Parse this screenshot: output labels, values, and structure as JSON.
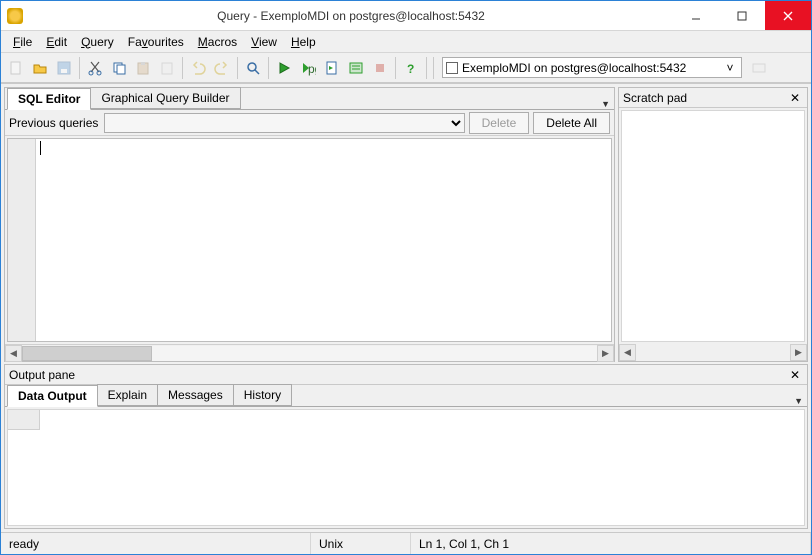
{
  "window": {
    "title": "Query - ExemploMDI on postgres@localhost:5432"
  },
  "menubar": {
    "file": "File",
    "edit": "Edit",
    "query": "Query",
    "favourites": "Favourites",
    "macros": "Macros",
    "view": "View",
    "help": "Help"
  },
  "toolbar": {
    "connection": "ExemploMDI on postgres@localhost:5432"
  },
  "editor": {
    "tab_sql": "SQL Editor",
    "tab_gqb": "Graphical Query Builder",
    "prev_label": "Previous queries",
    "delete": "Delete",
    "delete_all": "Delete All",
    "content": ""
  },
  "scratch": {
    "title": "Scratch pad"
  },
  "output": {
    "title": "Output pane",
    "tab_data": "Data Output",
    "tab_explain": "Explain",
    "tab_messages": "Messages",
    "tab_history": "History"
  },
  "status": {
    "state": "ready",
    "eol": "Unix",
    "pos": "Ln 1, Col 1, Ch 1"
  }
}
